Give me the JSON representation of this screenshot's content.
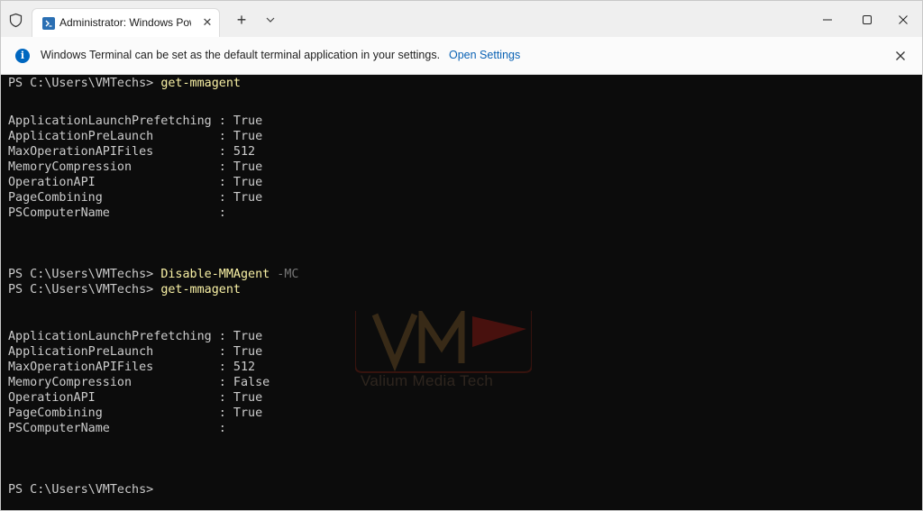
{
  "window": {
    "tab_title": "Administrator: Windows PowerShell",
    "new_tab_label": "+"
  },
  "infobar": {
    "message": "Windows Terminal can be set as the default terminal application in your settings.",
    "link_label": "Open Settings"
  },
  "terminal": {
    "lines": [
      {
        "prompt": "PS C:\\Users\\VMTechs> ",
        "command": "get-mmagent",
        "param": ""
      },
      {
        "text": "ApplicationLaunchPrefetching : True"
      },
      {
        "text": "ApplicationPreLaunch         : True"
      },
      {
        "text": "MaxOperationAPIFiles         : 512"
      },
      {
        "text": "MemoryCompression            : True"
      },
      {
        "text": "OperationAPI                 : True"
      },
      {
        "text": "PageCombining                : True"
      },
      {
        "text": "PSComputerName               :"
      },
      {
        "prompt": "PS C:\\Users\\VMTechs> ",
        "command": "Disable-MMAgent",
        "param": " -MC"
      },
      {
        "prompt": "PS C:\\Users\\VMTechs> ",
        "command": "get-mmagent",
        "param": ""
      },
      {
        "text": "ApplicationLaunchPrefetching : True"
      },
      {
        "text": "ApplicationPreLaunch         : True"
      },
      {
        "text": "MaxOperationAPIFiles         : 512"
      },
      {
        "text": "MemoryCompression            : False"
      },
      {
        "text": "OperationAPI                 : True"
      },
      {
        "text": "PageCombining                : True"
      },
      {
        "text": "PSComputerName               :"
      },
      {
        "prompt": "PS C:\\Users\\VMTechs>",
        "command": "",
        "param": ""
      }
    ]
  },
  "watermark": {
    "text": "Valium Media Tech"
  },
  "colors": {
    "terminal_bg": "#0c0c0c",
    "terminal_fg": "#cccccc",
    "command": "#f9f1a5",
    "parameter": "#767676",
    "link": "#0a62b4",
    "info_icon": "#0067c0"
  }
}
